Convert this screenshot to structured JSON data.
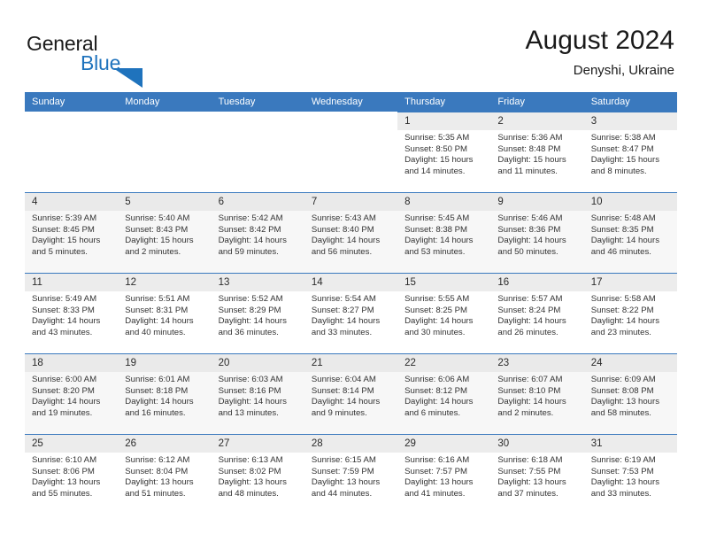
{
  "brand": {
    "name_part1": "General",
    "name_part2": "Blue",
    "logo_icon": "blue-triangle-icon",
    "accent_color": "#1f73bd"
  },
  "header": {
    "title": "August 2024",
    "subtitle": "Denyshi, Ukraine"
  },
  "colors": {
    "header_row": "#3a79be",
    "day_band": "#ececec",
    "row_alt": "#f7f7f7"
  },
  "calendar": {
    "weekday_headers": [
      "Sunday",
      "Monday",
      "Tuesday",
      "Wednesday",
      "Thursday",
      "Friday",
      "Saturday"
    ],
    "weeks": [
      [
        {
          "day": "",
          "sunrise": "",
          "sunset": "",
          "daylight": "",
          "daylight2": ""
        },
        {
          "day": "",
          "sunrise": "",
          "sunset": "",
          "daylight": "",
          "daylight2": ""
        },
        {
          "day": "",
          "sunrise": "",
          "sunset": "",
          "daylight": "",
          "daylight2": ""
        },
        {
          "day": "",
          "sunrise": "",
          "sunset": "",
          "daylight": "",
          "daylight2": ""
        },
        {
          "day": "1",
          "sunrise": "Sunrise: 5:35 AM",
          "sunset": "Sunset: 8:50 PM",
          "daylight": "Daylight: 15 hours",
          "daylight2": "and 14 minutes."
        },
        {
          "day": "2",
          "sunrise": "Sunrise: 5:36 AM",
          "sunset": "Sunset: 8:48 PM",
          "daylight": "Daylight: 15 hours",
          "daylight2": "and 11 minutes."
        },
        {
          "day": "3",
          "sunrise": "Sunrise: 5:38 AM",
          "sunset": "Sunset: 8:47 PM",
          "daylight": "Daylight: 15 hours",
          "daylight2": "and 8 minutes."
        }
      ],
      [
        {
          "day": "4",
          "sunrise": "Sunrise: 5:39 AM",
          "sunset": "Sunset: 8:45 PM",
          "daylight": "Daylight: 15 hours",
          "daylight2": "and 5 minutes."
        },
        {
          "day": "5",
          "sunrise": "Sunrise: 5:40 AM",
          "sunset": "Sunset: 8:43 PM",
          "daylight": "Daylight: 15 hours",
          "daylight2": "and 2 minutes."
        },
        {
          "day": "6",
          "sunrise": "Sunrise: 5:42 AM",
          "sunset": "Sunset: 8:42 PM",
          "daylight": "Daylight: 14 hours",
          "daylight2": "and 59 minutes."
        },
        {
          "day": "7",
          "sunrise": "Sunrise: 5:43 AM",
          "sunset": "Sunset: 8:40 PM",
          "daylight": "Daylight: 14 hours",
          "daylight2": "and 56 minutes."
        },
        {
          "day": "8",
          "sunrise": "Sunrise: 5:45 AM",
          "sunset": "Sunset: 8:38 PM",
          "daylight": "Daylight: 14 hours",
          "daylight2": "and 53 minutes."
        },
        {
          "day": "9",
          "sunrise": "Sunrise: 5:46 AM",
          "sunset": "Sunset: 8:36 PM",
          "daylight": "Daylight: 14 hours",
          "daylight2": "and 50 minutes."
        },
        {
          "day": "10",
          "sunrise": "Sunrise: 5:48 AM",
          "sunset": "Sunset: 8:35 PM",
          "daylight": "Daylight: 14 hours",
          "daylight2": "and 46 minutes."
        }
      ],
      [
        {
          "day": "11",
          "sunrise": "Sunrise: 5:49 AM",
          "sunset": "Sunset: 8:33 PM",
          "daylight": "Daylight: 14 hours",
          "daylight2": "and 43 minutes."
        },
        {
          "day": "12",
          "sunrise": "Sunrise: 5:51 AM",
          "sunset": "Sunset: 8:31 PM",
          "daylight": "Daylight: 14 hours",
          "daylight2": "and 40 minutes."
        },
        {
          "day": "13",
          "sunrise": "Sunrise: 5:52 AM",
          "sunset": "Sunset: 8:29 PM",
          "daylight": "Daylight: 14 hours",
          "daylight2": "and 36 minutes."
        },
        {
          "day": "14",
          "sunrise": "Sunrise: 5:54 AM",
          "sunset": "Sunset: 8:27 PM",
          "daylight": "Daylight: 14 hours",
          "daylight2": "and 33 minutes."
        },
        {
          "day": "15",
          "sunrise": "Sunrise: 5:55 AM",
          "sunset": "Sunset: 8:25 PM",
          "daylight": "Daylight: 14 hours",
          "daylight2": "and 30 minutes."
        },
        {
          "day": "16",
          "sunrise": "Sunrise: 5:57 AM",
          "sunset": "Sunset: 8:24 PM",
          "daylight": "Daylight: 14 hours",
          "daylight2": "and 26 minutes."
        },
        {
          "day": "17",
          "sunrise": "Sunrise: 5:58 AM",
          "sunset": "Sunset: 8:22 PM",
          "daylight": "Daylight: 14 hours",
          "daylight2": "and 23 minutes."
        }
      ],
      [
        {
          "day": "18",
          "sunrise": "Sunrise: 6:00 AM",
          "sunset": "Sunset: 8:20 PM",
          "daylight": "Daylight: 14 hours",
          "daylight2": "and 19 minutes."
        },
        {
          "day": "19",
          "sunrise": "Sunrise: 6:01 AM",
          "sunset": "Sunset: 8:18 PM",
          "daylight": "Daylight: 14 hours",
          "daylight2": "and 16 minutes."
        },
        {
          "day": "20",
          "sunrise": "Sunrise: 6:03 AM",
          "sunset": "Sunset: 8:16 PM",
          "daylight": "Daylight: 14 hours",
          "daylight2": "and 13 minutes."
        },
        {
          "day": "21",
          "sunrise": "Sunrise: 6:04 AM",
          "sunset": "Sunset: 8:14 PM",
          "daylight": "Daylight: 14 hours",
          "daylight2": "and 9 minutes."
        },
        {
          "day": "22",
          "sunrise": "Sunrise: 6:06 AM",
          "sunset": "Sunset: 8:12 PM",
          "daylight": "Daylight: 14 hours",
          "daylight2": "and 6 minutes."
        },
        {
          "day": "23",
          "sunrise": "Sunrise: 6:07 AM",
          "sunset": "Sunset: 8:10 PM",
          "daylight": "Daylight: 14 hours",
          "daylight2": "and 2 minutes."
        },
        {
          "day": "24",
          "sunrise": "Sunrise: 6:09 AM",
          "sunset": "Sunset: 8:08 PM",
          "daylight": "Daylight: 13 hours",
          "daylight2": "and 58 minutes."
        }
      ],
      [
        {
          "day": "25",
          "sunrise": "Sunrise: 6:10 AM",
          "sunset": "Sunset: 8:06 PM",
          "daylight": "Daylight: 13 hours",
          "daylight2": "and 55 minutes."
        },
        {
          "day": "26",
          "sunrise": "Sunrise: 6:12 AM",
          "sunset": "Sunset: 8:04 PM",
          "daylight": "Daylight: 13 hours",
          "daylight2": "and 51 minutes."
        },
        {
          "day": "27",
          "sunrise": "Sunrise: 6:13 AM",
          "sunset": "Sunset: 8:02 PM",
          "daylight": "Daylight: 13 hours",
          "daylight2": "and 48 minutes."
        },
        {
          "day": "28",
          "sunrise": "Sunrise: 6:15 AM",
          "sunset": "Sunset: 7:59 PM",
          "daylight": "Daylight: 13 hours",
          "daylight2": "and 44 minutes."
        },
        {
          "day": "29",
          "sunrise": "Sunrise: 6:16 AM",
          "sunset": "Sunset: 7:57 PM",
          "daylight": "Daylight: 13 hours",
          "daylight2": "and 41 minutes."
        },
        {
          "day": "30",
          "sunrise": "Sunrise: 6:18 AM",
          "sunset": "Sunset: 7:55 PM",
          "daylight": "Daylight: 13 hours",
          "daylight2": "and 37 minutes."
        },
        {
          "day": "31",
          "sunrise": "Sunrise: 6:19 AM",
          "sunset": "Sunset: 7:53 PM",
          "daylight": "Daylight: 13 hours",
          "daylight2": "and 33 minutes."
        }
      ]
    ]
  }
}
